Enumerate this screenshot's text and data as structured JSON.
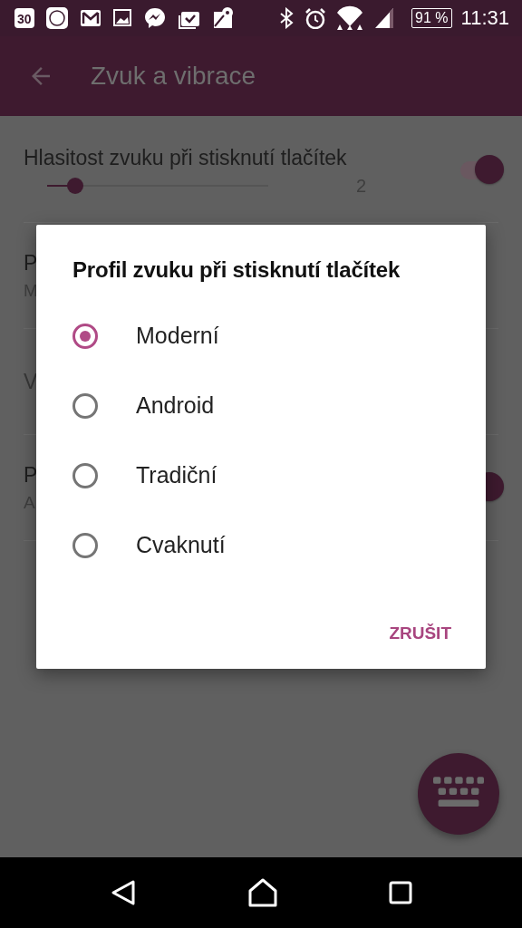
{
  "status_bar": {
    "calendar_day": "30",
    "battery": "91 %",
    "time": "11:31"
  },
  "app_bar": {
    "title": "Zvuk a vibrace"
  },
  "settings": [
    {
      "kind": "slider",
      "title": "Hlasitost zvuku při stisknutí tlačítek",
      "level": 0.12,
      "reading": "2",
      "on": true
    },
    {
      "kind": "text",
      "title": "P",
      "subtitle": "M"
    },
    {
      "kind": "text",
      "title": "V"
    },
    {
      "kind": "switch",
      "title": "P",
      "subtitle": "A",
      "on": true
    }
  ],
  "dialog": {
    "title": "Profil zvuku při stisknutí tlačítek",
    "options": [
      {
        "label": "Moderní",
        "selected": true
      },
      {
        "label": "Android",
        "selected": false
      },
      {
        "label": "Tradiční",
        "selected": false
      },
      {
        "label": "Cvaknutí",
        "selected": false
      }
    ],
    "buttons": [
      "ZRUŠIT"
    ]
  }
}
